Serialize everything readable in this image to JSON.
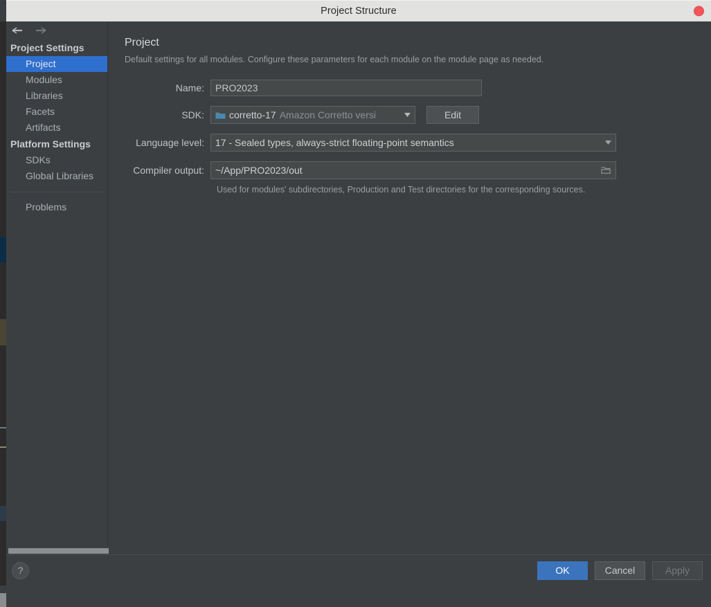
{
  "window": {
    "title": "Project Structure",
    "close_icon": "close-circle-icon"
  },
  "nav": {
    "back_icon": "arrow-left-icon",
    "forward_icon": "arrow-right-icon"
  },
  "sidebar": {
    "sections": [
      {
        "heading": "Project Settings",
        "items": [
          {
            "label": "Project",
            "selected": true
          },
          {
            "label": "Modules",
            "selected": false
          },
          {
            "label": "Libraries",
            "selected": false
          },
          {
            "label": "Facets",
            "selected": false
          },
          {
            "label": "Artifacts",
            "selected": false
          }
        ]
      },
      {
        "heading": "Platform Settings",
        "items": [
          {
            "label": "SDKs",
            "selected": false
          },
          {
            "label": "Global Libraries",
            "selected": false
          }
        ]
      }
    ],
    "problems_label": "Problems"
  },
  "main": {
    "title": "Project",
    "description": "Default settings for all modules. Configure these parameters for each module on the module page as needed.",
    "fields": {
      "name": {
        "label": "Name:",
        "value": "PRO2023",
        "placeholder": ""
      },
      "sdk": {
        "label": "SDK:",
        "icon": "sdk-folder-icon",
        "value": "corretto-17",
        "detail": "Amazon Corretto versi",
        "dropdown_icon": "chevron-down-icon",
        "edit_button": "Edit"
      },
      "language_level": {
        "label": "Language level:",
        "value": "17 - Sealed types, always-strict floating-point semantics",
        "dropdown_icon": "chevron-down-icon"
      },
      "compiler_output": {
        "label": "Compiler output:",
        "value": "~/App/PRO2023/out",
        "browse_icon": "folder-browse-icon",
        "hint": "Used for modules' subdirectories, Production and Test directories for the corresponding sources."
      }
    }
  },
  "footer": {
    "help_label": "?",
    "help_icon": "question-mark-icon",
    "ok_label": "OK",
    "cancel_label": "Cancel",
    "apply_label": "Apply",
    "apply_enabled": false
  },
  "colors": {
    "accent_selection": "#2f6fce",
    "primary_button": "#3b74bd",
    "close_button": "#f2555a",
    "panel_bg": "#3c3f41",
    "titlebar_bg": "#e2e2e0",
    "sdk_icon": "#3592c4"
  }
}
